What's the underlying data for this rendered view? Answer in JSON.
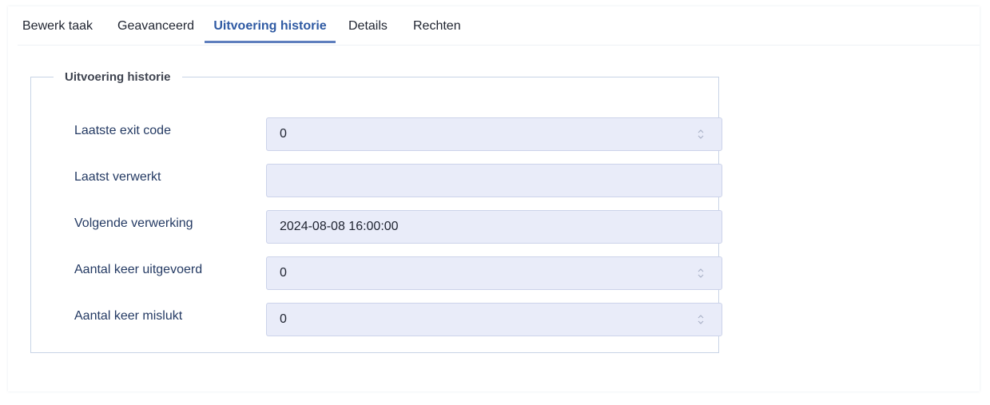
{
  "tabs": [
    {
      "label": "Bewerk taak",
      "active": false
    },
    {
      "label": "Geavanceerd",
      "active": false
    },
    {
      "label": "Uitvoering historie",
      "active": true
    },
    {
      "label": "Details",
      "active": false
    },
    {
      "label": "Rechten",
      "active": false
    }
  ],
  "section": {
    "legend": "Uitvoering historie"
  },
  "fields": {
    "last_exit_code": {
      "label": "Laatste exit code",
      "value": "0",
      "icon": "spinner-arrows-icon"
    },
    "last_processed": {
      "label": "Laatst verwerkt",
      "value": ""
    },
    "next_processing": {
      "label": "Volgende verwerking",
      "value": "2024-08-08 16:00:00"
    },
    "times_executed": {
      "label": "Aantal keer uitgevoerd",
      "value": "0",
      "icon": "spinner-arrows-icon"
    },
    "times_failed": {
      "label": "Aantal keer mislukt",
      "value": "0",
      "icon": "spinner-arrows-icon"
    }
  },
  "colors": {
    "active_tab": "#2f5aa3",
    "active_tab_underline": "#5f7fbe",
    "label_text": "#243a63",
    "field_background": "#eef0fb",
    "field_border": "#ccd3ea",
    "fieldset_border": "#c8d4e6"
  }
}
